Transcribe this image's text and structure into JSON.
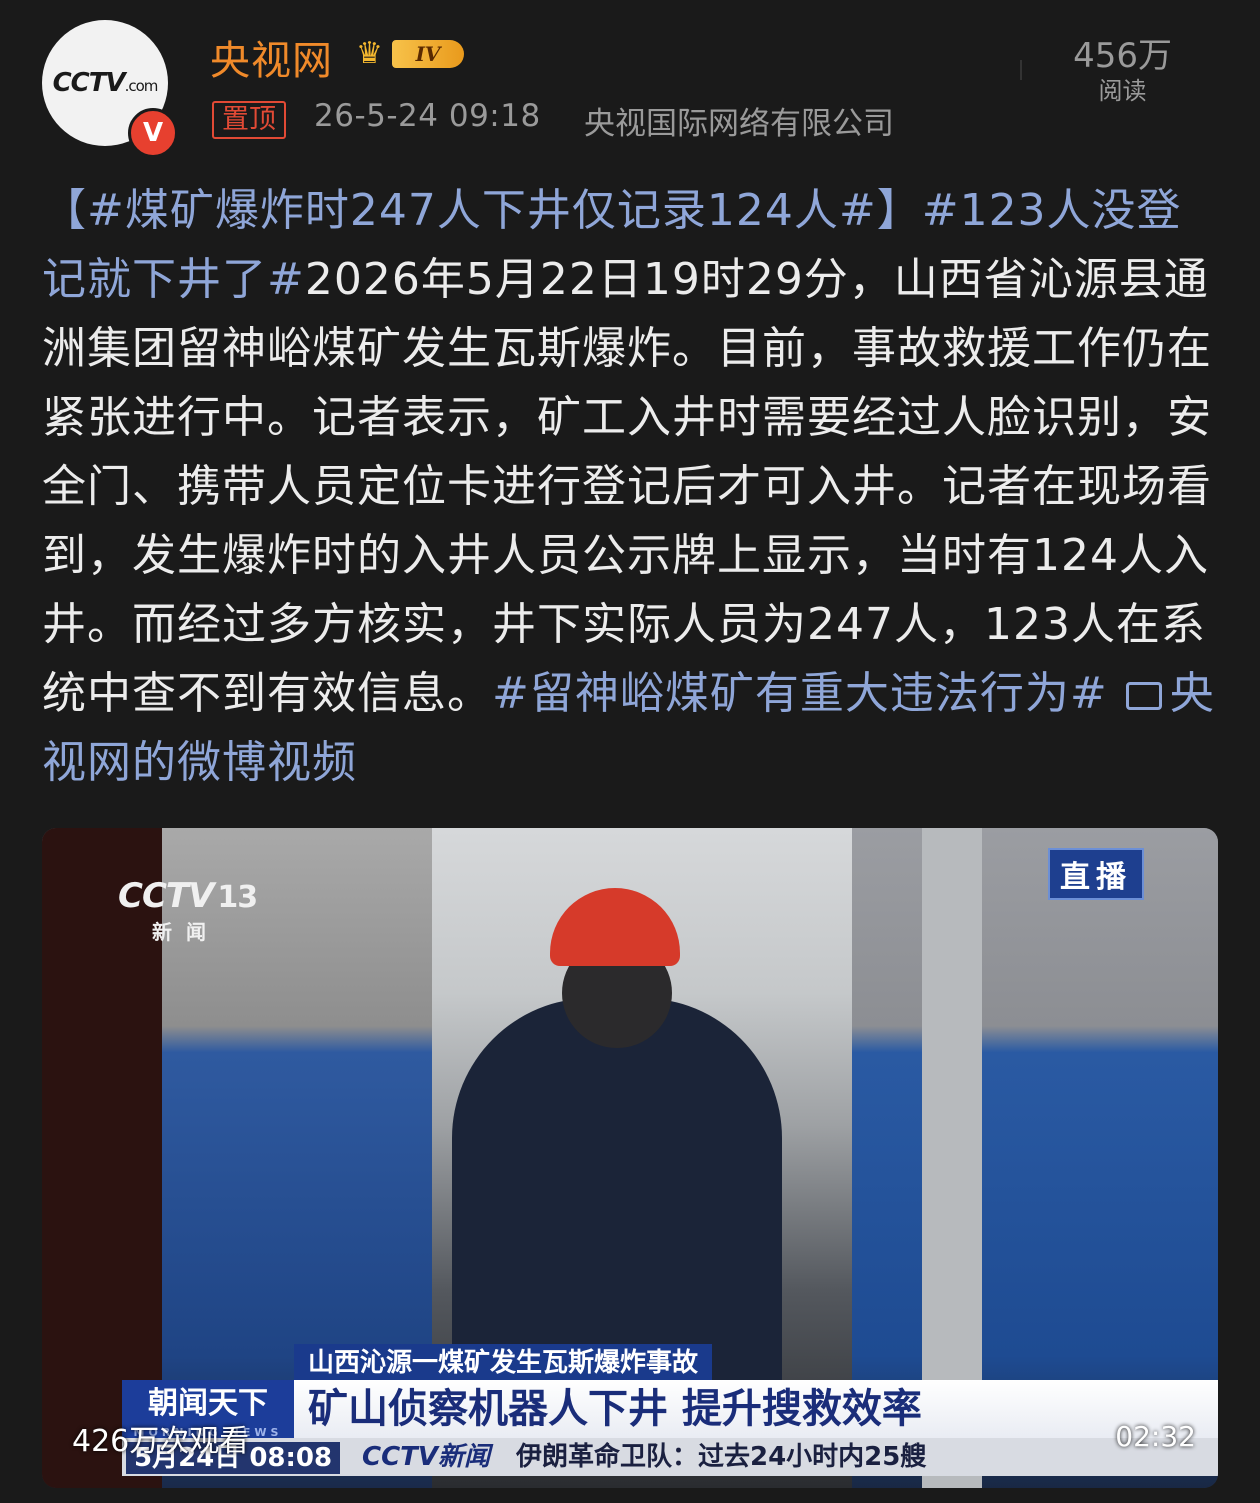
{
  "header": {
    "author": "央视网",
    "level": "IV",
    "pinned_label": "置顶",
    "timestamp": "26-5-24 09:18",
    "source": "央视国际网络有限公司",
    "views_count": "456万",
    "views_label": "阅读",
    "avatar_text": "CCTV",
    "avatar_sub": ".com"
  },
  "post": {
    "topic1": "【#煤矿爆炸时247人下井仅记录124人#】",
    "topic2": "#123人没登记就下井了#",
    "body": "2026年5月22日19时29分，山西省沁源县通洲集团留神峪煤矿发生瓦斯爆炸。目前，事故救援工作仍在紧张进行中。记者表示，矿工入井时需要经过人脸识别，安全门、携带人员定位卡进行登记后才可入井。记者在现场看到，发生爆炸时的入井人员公示牌上显示，当时有124人入井。而经过多方核实，井下实际人员为247人，123人在系统中查不到有效信息。",
    "topic3": "#留神峪煤矿有重大违法行为#",
    "video_link": "央视网的微博视频"
  },
  "video": {
    "channel_logo": "CCTV",
    "channel_num": "13",
    "channel_sub": "新闻",
    "live_badge": "直播",
    "ticker_top": "山西沁源一煤矿发生瓦斯爆炸事故",
    "ticker_main": "矿山侦察机器人下井 提升搜救效率",
    "show_name": "朝闻天下",
    "show_name_en": "MORNING NEWS",
    "ticker_logo": "CCTV新闻",
    "ticker_news": "伊朗革命卫队：过去24小时内25艘",
    "ticker_date": "5月24日 08:08",
    "play_count": "426万次观看",
    "duration": "02:32"
  }
}
